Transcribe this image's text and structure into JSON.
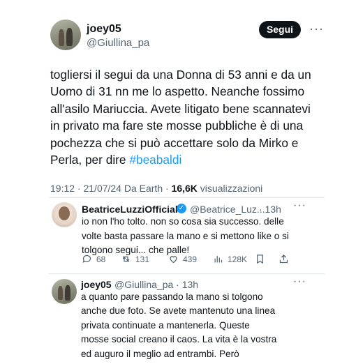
{
  "main_tweet": {
    "display_name": "joey05",
    "handle": "@Giullina_pa",
    "follow_label": "Segui",
    "body_text": "togliersi il segui da una Donna di 53 anni e da un Uomo di 31 nn me lo aspetto. Neanche fossimo all'asilo Mariuccia. Avete litigato bene  scannatevi in privato ma fare ste mosse pubbliche è di una pochezza che si può accettare solo da Mirko e Perla, per dire ",
    "hashtag": "#beabaldi",
    "timestamp": "19:12 · 21/07/24 Da Earth · ",
    "views_count": "16,6K",
    "views_label": " visualizzazioni"
  },
  "reply_1": {
    "display_name": "BeatriceLuzziOfficial",
    "verified_icon": "verified-badge-icon",
    "handle": "@Beatrice_Luz...",
    "time": "· 13h",
    "text": "io non l'ho tolto. non so cosa sia successo. delle volte basta passare la mano e si mettono like o si tolgono segui... che palle!",
    "stats": {
      "replies": "68",
      "retweets": "131",
      "likes": "439",
      "views": "128K"
    }
  },
  "reply_2": {
    "display_name": "joey05",
    "handle": "@Giullina_pa · 13h",
    "text": "a quanto pare passando la mano si tolgono anche due foto. Se avete mantenuto una linea privata continuate a mantenerla. Queste mosse social creano il caos. La vita è la vostra ed auguro il meglio ad entrambi. Però perdonami ma questa risposta nn ha senso"
  },
  "colors": {
    "text": "#0f1419",
    "secondary": "#536471",
    "accent": "#1d9bf0",
    "button_bg": "#0f1419"
  }
}
